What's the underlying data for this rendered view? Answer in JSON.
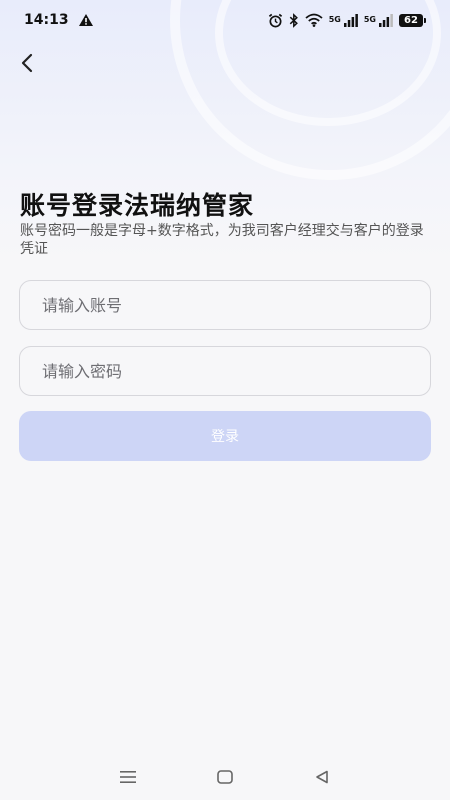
{
  "status_bar": {
    "time": "14:13",
    "signal1_label": "5G",
    "signal2_label": "5G",
    "battery": "62",
    "icons": [
      "warning-icon",
      "alarm-icon",
      "bluetooth-icon",
      "wifi-icon",
      "signal-icon",
      "signal-icon",
      "battery-icon"
    ]
  },
  "header": {
    "back_icon": "chevron-left-icon"
  },
  "login": {
    "title": "账号登录法瑞纳管家",
    "subtitle": "账号密码一般是字母+数字格式，为我司客户经理交与客户的登录凭证",
    "account_placeholder": "请输入账号",
    "account_value": "",
    "password_placeholder": "请输入密码",
    "password_value": "",
    "login_label": "登录"
  },
  "nav_bar": {
    "icons": [
      "menu-icon",
      "home-icon",
      "back-triangle-icon"
    ]
  },
  "colors": {
    "button_disabled": "#cdd5f6",
    "header_tint": "#e8ecfb",
    "background": "#f7f7f9"
  }
}
